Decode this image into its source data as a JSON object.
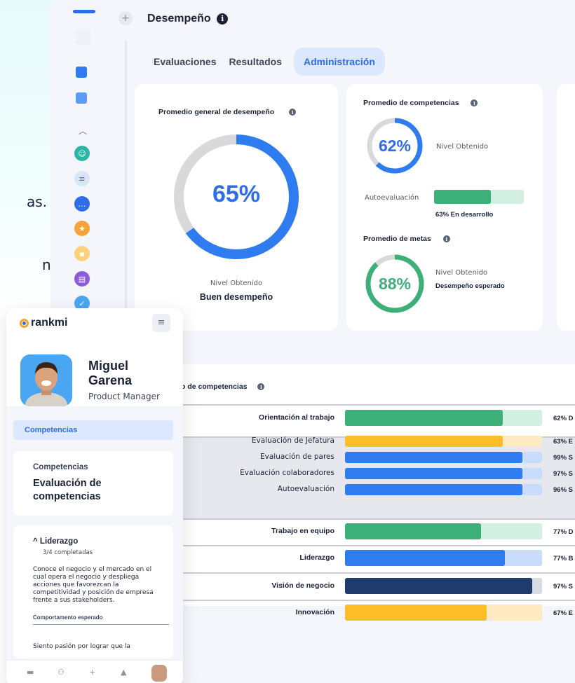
{
  "background_fragments": {
    "fragment_1": "as.",
    "fragment_2": "n"
  },
  "dashboard": {
    "title": "Desempeño",
    "tabs": [
      {
        "label": "Evaluaciones",
        "active": false
      },
      {
        "label": "Resultados",
        "active": false
      },
      {
        "label": "Administración",
        "active": true
      }
    ],
    "overall": {
      "title": "Promedio general de desempeño",
      "percent": "65%",
      "percent_value": 65,
      "level_label": "Nivel Obtenido",
      "level_value": "Buen desempeño"
    },
    "competencies": {
      "title": "Promedio de competencias",
      "percent": "62%",
      "percent_value": 62,
      "level_label": "Nivel Obtenido",
      "self_label": "Autoevaluación",
      "self_value": 63,
      "self_text": "63% En desarrollo"
    },
    "goals": {
      "title": "Promedio de metas",
      "percent": "88%",
      "percent_value": 88,
      "level_label": "Nivel Obtenido",
      "level_value": "Desempeño esperado"
    },
    "table": {
      "title": "o de competencias",
      "rows": [
        {
          "label": "Orientación al trabajo",
          "bold": true,
          "value": 80,
          "fill": "#3db07a",
          "track": "#d3efe1",
          "text": "62% D",
          "shaded": false
        },
        {
          "label": "Evaluación de Jefatura",
          "bold": false,
          "value": 80,
          "fill": "#fbbd28",
          "track": "#fdeac2",
          "text": "63% E",
          "shaded": true
        },
        {
          "label": "Evaluación de pares",
          "bold": false,
          "value": 90,
          "fill": "#2f7bf0",
          "track": "#c9dcfb",
          "text": "99% S",
          "shaded": true
        },
        {
          "label": "Evaluación colaboradores",
          "bold": false,
          "value": 90,
          "fill": "#2f7bf0",
          "track": "#c9dcfb",
          "text": "97% S",
          "shaded": true
        },
        {
          "label": "Autoevaluación",
          "bold": false,
          "value": 90,
          "fill": "#2f7bf0",
          "track": "#c9dcfb",
          "text": "96% S",
          "shaded": true
        },
        {
          "label": "Trabajo en equipo",
          "bold": true,
          "value": 69,
          "fill": "#3db07a",
          "track": "#d3efe1",
          "text": "77% D",
          "shaded": false
        },
        {
          "label": "Liderazgo",
          "bold": true,
          "value": 81,
          "fill": "#2f7bf0",
          "track": "#c9dcfb",
          "text": "77% B",
          "shaded": false
        },
        {
          "label": "Visión de negocio",
          "bold": true,
          "value": 95,
          "fill": "#1f3b6b",
          "track": "#d7dbe2",
          "text": "97% S",
          "shaded": false
        },
        {
          "label": "Innovación",
          "bold": true,
          "value": 72,
          "fill": "#fbbd28",
          "track": "#fdeac2",
          "text": "67% E",
          "shaded": false
        }
      ]
    }
  },
  "mobile": {
    "logo": "rankmi",
    "name": "Miguel Garena",
    "role": "Product Manager",
    "tab": "Competencias",
    "section_kicker": "Competencias",
    "section_title": "Evaluación de competencias",
    "group_title": "Liderazgo",
    "group_progress": "3/4 completadas",
    "behavior_text": "Conoce el negocio y el mercado en el cual opera el negocio y despliega acciones que favorezcan la competitividad y posición de empresa frente a sus stakeholders.",
    "behavior_caption": "Comportamento esperado",
    "next_text": "Siento pasión por lograr que la"
  },
  "colors": {
    "accent_blue": "#2f6de8",
    "green": "#3db07a",
    "yellow": "#fbbd28",
    "navy": "#1f3b6b"
  }
}
